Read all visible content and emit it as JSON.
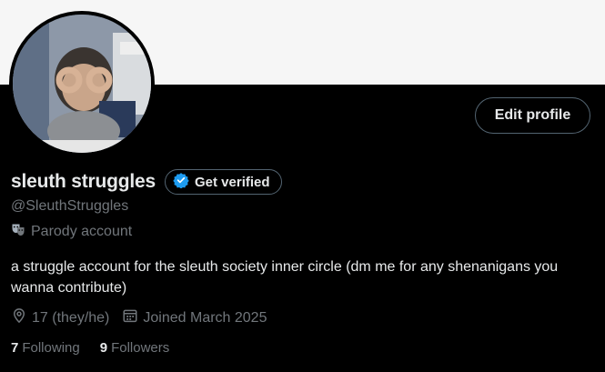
{
  "profile": {
    "display_name": "sleuth struggles",
    "handle": "@SleuthStruggles",
    "parody_label": "Parody account",
    "bio": "a struggle account for the sleuth society inner circle (dm me for any shenanigans you wanna contribute)",
    "location": "17 (they/he)",
    "joined": "Joined March 2025",
    "following_count": "7",
    "following_label": "Following",
    "followers_count": "9",
    "followers_label": "Followers"
  },
  "buttons": {
    "edit_profile": "Edit profile",
    "get_verified": "Get verified"
  },
  "icons": {
    "verified": "verified-badge-icon",
    "parody": "theater-masks-icon",
    "location": "location-pin-icon",
    "calendar": "calendar-icon"
  },
  "colors": {
    "background": "#000000",
    "banner": "#f6f6f6",
    "text_primary": "#e7e9ea",
    "text_secondary": "#71767b",
    "border": "#536471",
    "verified_blue": "#1d9bf0"
  }
}
